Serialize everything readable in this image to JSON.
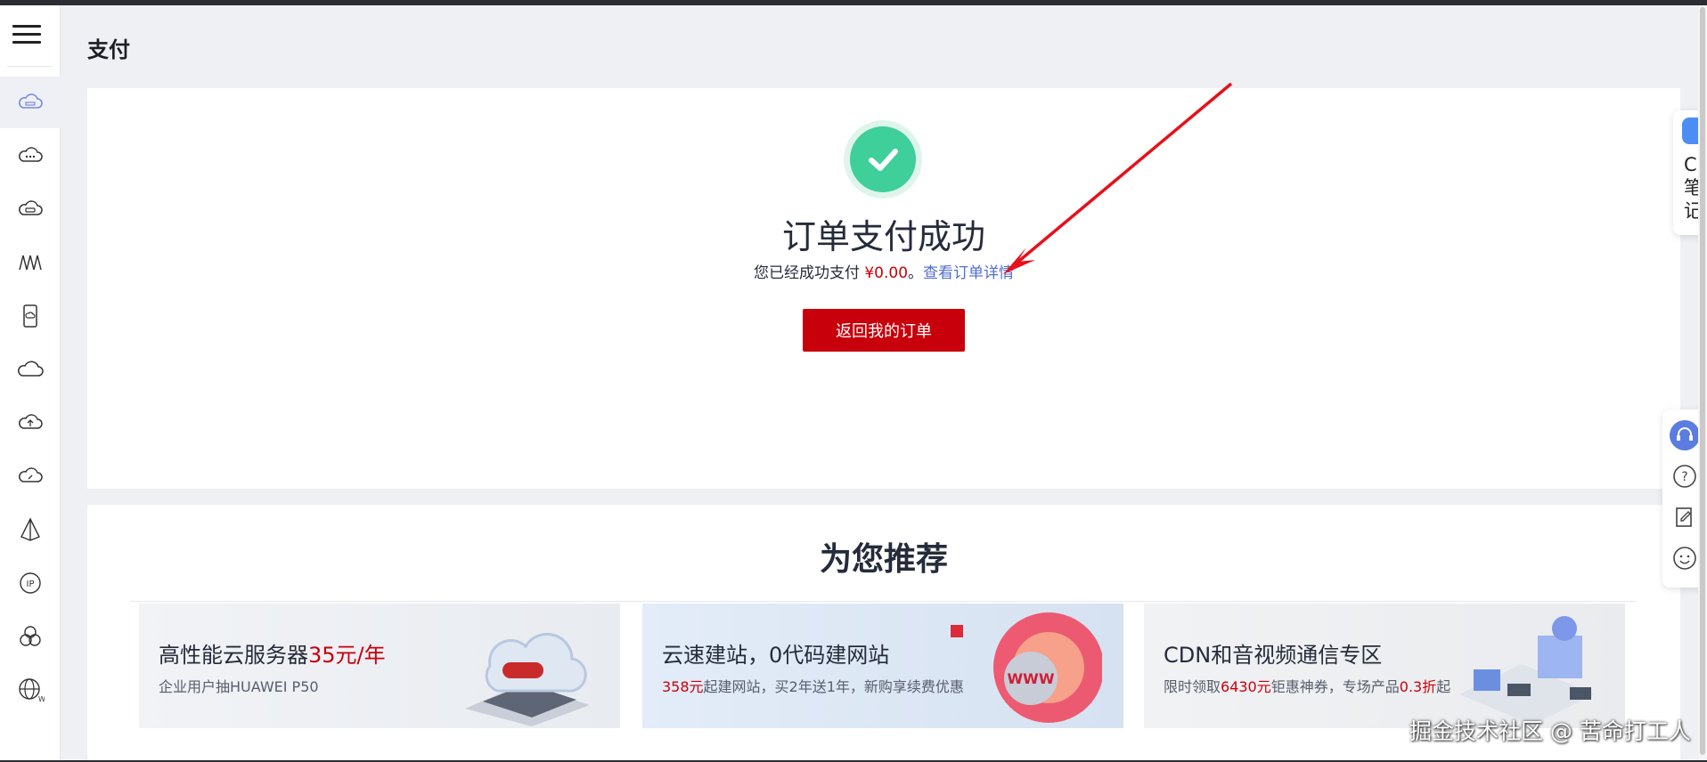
{
  "page": {
    "title": "支付"
  },
  "sidebar": {
    "menu_icon": "hamburger-menu-icon",
    "items": [
      {
        "icon": "cloud-server-icon",
        "active": true
      },
      {
        "icon": "cloud-dots-icon"
      },
      {
        "icon": "cloud-database-icon"
      },
      {
        "icon": "waveform-icon"
      },
      {
        "icon": "mobile-cloud-icon"
      },
      {
        "icon": "cloud-outline-icon"
      },
      {
        "icon": "cloud-upload-icon"
      },
      {
        "icon": "cloud-gauge-icon"
      },
      {
        "icon": "pyramid-icon"
      },
      {
        "icon": "ip-icon"
      },
      {
        "icon": "cluster-icon"
      },
      {
        "icon": "globe-w-icon"
      }
    ]
  },
  "success": {
    "title": "订单支付成功",
    "desc_prefix": "您已经成功支付 ",
    "amount": "¥0.00",
    "desc_sep": "。",
    "detail_link": "查看订单详情",
    "back_button": "返回我的订单",
    "check_color": "#3fcf9a"
  },
  "recommend": {
    "title": "为您推荐",
    "banners": [
      {
        "title": "高性能云服务器",
        "title_highlight": "35元/年",
        "sub_prefix": "企业用户抽HUAWEI P50",
        "sub_highlight": "",
        "sub_suffix": ""
      },
      {
        "title": "云速建站，0代码建网站",
        "title_highlight": "",
        "sub_prefix": "",
        "sub_highlight": "358元",
        "sub_suffix": "起建网站，买2年送1年，新购享续费优惠"
      },
      {
        "title": "CDN和音视频通信专区",
        "title_highlight": "",
        "sub_prefix": "限时领取",
        "sub_highlight": "6430元",
        "sub_suffix": "钜惠神券，专场产品",
        "sub_highlight2": "0.3折",
        "sub_suffix2": "起"
      }
    ]
  },
  "float_note": {
    "text": "C笔记"
  },
  "float_tools": [
    "headset-icon",
    "help-icon",
    "edit-note-icon",
    "smile-icon"
  ],
  "watermark": "掘金技术社区 @ 苦命打工人",
  "colors": {
    "brand_red": "#c7000b",
    "link_blue": "#526ecc",
    "success_green": "#3fcf9a"
  }
}
